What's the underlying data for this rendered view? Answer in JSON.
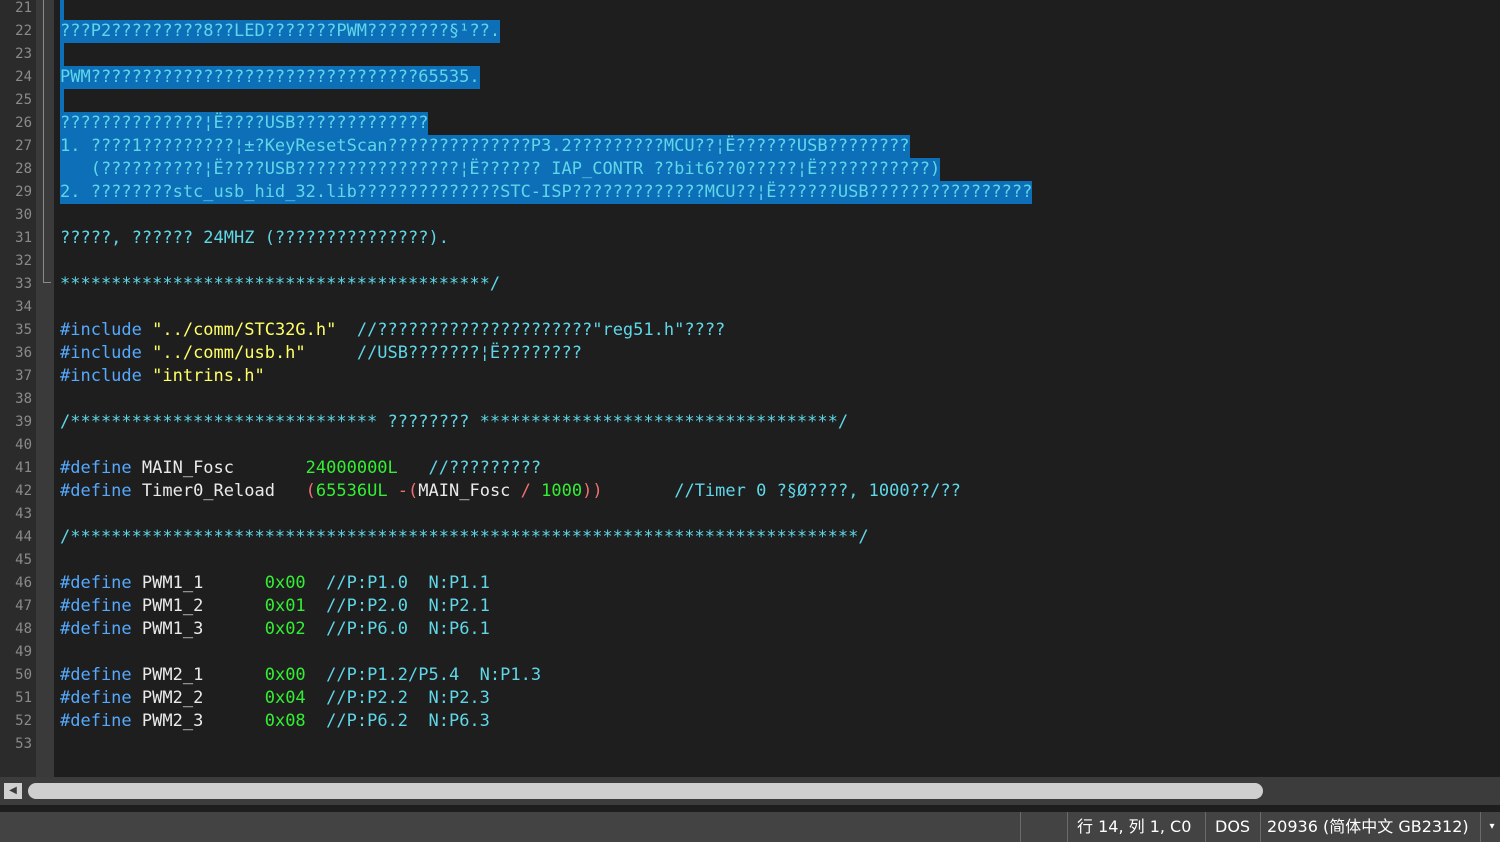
{
  "editor": {
    "lines": [
      {
        "n": "21",
        "selected": true,
        "tokens": []
      },
      {
        "n": "22",
        "selected": true,
        "tokens": [
          {
            "t": "???P2?????????8??LED???????PWM????????§¹??.",
            "c": "com"
          }
        ]
      },
      {
        "n": "23",
        "selected": true,
        "tokens": []
      },
      {
        "n": "24",
        "selected": true,
        "tokens": [
          {
            "t": "PWM????????????????????????????????65535.",
            "c": "com"
          }
        ]
      },
      {
        "n": "25",
        "selected": true,
        "tokens": []
      },
      {
        "n": "26",
        "selected": true,
        "tokens": [
          {
            "t": "??????????????¦Ë????USB?????????????",
            "c": "com"
          }
        ]
      },
      {
        "n": "27",
        "selected": true,
        "tokens": [
          {
            "t": "1. ????1?????????¦±?KeyResetScan??????????????P3.2?????????MCU??¦Ë??????USB????????",
            "c": "com"
          }
        ]
      },
      {
        "n": "28",
        "selected": true,
        "tokens": [
          {
            "t": "   (??????????¦Ë????USB????????????????¦Ë?????? IAP_CONTR ??bit6??0?????¦Ë???????????)",
            "c": "com"
          }
        ]
      },
      {
        "n": "29",
        "selected": true,
        "tokens": [
          {
            "t": "2. ????????stc_usb_hid_32.lib??????????????STC-ISP?????????????MCU??¦Ë??????USB????????????????",
            "c": "com"
          }
        ]
      },
      {
        "n": "30",
        "selected": false,
        "tokens": []
      },
      {
        "n": "31",
        "selected": false,
        "tokens": [
          {
            "t": "?????, ?????? 24MHZ (???????????????).",
            "c": "com"
          }
        ]
      },
      {
        "n": "32",
        "selected": false,
        "tokens": []
      },
      {
        "n": "33",
        "selected": false,
        "tokens": [
          {
            "t": "******************************************/",
            "c": "com"
          }
        ]
      },
      {
        "n": "34",
        "selected": false,
        "tokens": []
      },
      {
        "n": "35",
        "selected": false,
        "tokens": [
          {
            "t": "#include ",
            "c": "kw"
          },
          {
            "t": "\"../comm/STC32G.h\"",
            "c": "str"
          },
          {
            "t": "  //?????????????????????\"reg51.h\"????",
            "c": "com"
          }
        ]
      },
      {
        "n": "36",
        "selected": false,
        "tokens": [
          {
            "t": "#include ",
            "c": "kw"
          },
          {
            "t": "\"../comm/usb.h\"",
            "c": "str"
          },
          {
            "t": "     //USB???????¦Ë????????",
            "c": "com"
          }
        ]
      },
      {
        "n": "37",
        "selected": false,
        "tokens": [
          {
            "t": "#include ",
            "c": "kw"
          },
          {
            "t": "\"intrins.h\"",
            "c": "str"
          }
        ]
      },
      {
        "n": "38",
        "selected": false,
        "tokens": []
      },
      {
        "n": "39",
        "selected": false,
        "tokens": [
          {
            "t": "/****************************** ???????? ***********************************/",
            "c": "com"
          }
        ]
      },
      {
        "n": "40",
        "selected": false,
        "tokens": []
      },
      {
        "n": "41",
        "selected": false,
        "tokens": [
          {
            "t": "#define ",
            "c": "kw"
          },
          {
            "t": "MAIN_Fosc       ",
            "c": "def"
          },
          {
            "t": "24000000L",
            "c": "num"
          },
          {
            "t": "   //?????????",
            "c": "com"
          }
        ]
      },
      {
        "n": "42",
        "selected": false,
        "tokens": [
          {
            "t": "#define ",
            "c": "kw"
          },
          {
            "t": "Timer0_Reload   ",
            "c": "def"
          },
          {
            "t": "(",
            "c": "op"
          },
          {
            "t": "65536UL",
            "c": "num"
          },
          {
            "t": " -",
            "c": "op"
          },
          {
            "t": "(",
            "c": "op"
          },
          {
            "t": "MAIN_Fosc",
            "c": "def"
          },
          {
            "t": " / ",
            "c": "op"
          },
          {
            "t": "1000",
            "c": "num"
          },
          {
            "t": "))",
            "c": "op"
          },
          {
            "t": "       //Timer 0 ?§Ø????, 1000??/??",
            "c": "com"
          }
        ]
      },
      {
        "n": "43",
        "selected": false,
        "tokens": []
      },
      {
        "n": "44",
        "selected": false,
        "tokens": [
          {
            "t": "/*****************************************************************************/",
            "c": "com"
          }
        ]
      },
      {
        "n": "45",
        "selected": false,
        "tokens": []
      },
      {
        "n": "46",
        "selected": false,
        "tokens": [
          {
            "t": "#define ",
            "c": "kw"
          },
          {
            "t": "PWM1_1      ",
            "c": "def"
          },
          {
            "t": "0x00",
            "c": "num"
          },
          {
            "t": "  //P:P1.0  N:P1.1",
            "c": "com"
          }
        ]
      },
      {
        "n": "47",
        "selected": false,
        "tokens": [
          {
            "t": "#define ",
            "c": "kw"
          },
          {
            "t": "PWM1_2      ",
            "c": "def"
          },
          {
            "t": "0x01",
            "c": "num"
          },
          {
            "t": "  //P:P2.0  N:P2.1",
            "c": "com"
          }
        ]
      },
      {
        "n": "48",
        "selected": false,
        "tokens": [
          {
            "t": "#define ",
            "c": "kw"
          },
          {
            "t": "PWM1_3      ",
            "c": "def"
          },
          {
            "t": "0x02",
            "c": "num"
          },
          {
            "t": "  //P:P6.0  N:P6.1",
            "c": "com"
          }
        ]
      },
      {
        "n": "49",
        "selected": false,
        "tokens": []
      },
      {
        "n": "50",
        "selected": false,
        "tokens": [
          {
            "t": "#define ",
            "c": "kw"
          },
          {
            "t": "PWM2_1      ",
            "c": "def"
          },
          {
            "t": "0x00",
            "c": "num"
          },
          {
            "t": "  //P:P1.2/P5.4  N:P1.3",
            "c": "com"
          }
        ]
      },
      {
        "n": "51",
        "selected": false,
        "tokens": [
          {
            "t": "#define ",
            "c": "kw"
          },
          {
            "t": "PWM2_2      ",
            "c": "def"
          },
          {
            "t": "0x04",
            "c": "num"
          },
          {
            "t": "  //P:P2.2  N:P2.3",
            "c": "com"
          }
        ]
      },
      {
        "n": "52",
        "selected": false,
        "tokens": [
          {
            "t": "#define ",
            "c": "kw"
          },
          {
            "t": "PWM2_3      ",
            "c": "def"
          },
          {
            "t": "0x08",
            "c": "num"
          },
          {
            "t": "  //P:P6.2  N:P6.3",
            "c": "com"
          }
        ]
      },
      {
        "n": "53",
        "selected": false,
        "tokens": []
      }
    ]
  },
  "scrollbar": {
    "left_arrow": "◀"
  },
  "statusbar": {
    "position": "行 14, 列 1, C0",
    "line_ending": "DOS",
    "encoding": "20936  (简体中文 GB2312)",
    "dropdown_icon": "▾"
  },
  "colors": {
    "selection": "#0d6fb8",
    "comment": "#5fd7e8",
    "keyword": "#55aaff",
    "string": "#ffff66",
    "number": "#33ee33",
    "operator": "#f07070",
    "background": "#1e1e1e"
  }
}
